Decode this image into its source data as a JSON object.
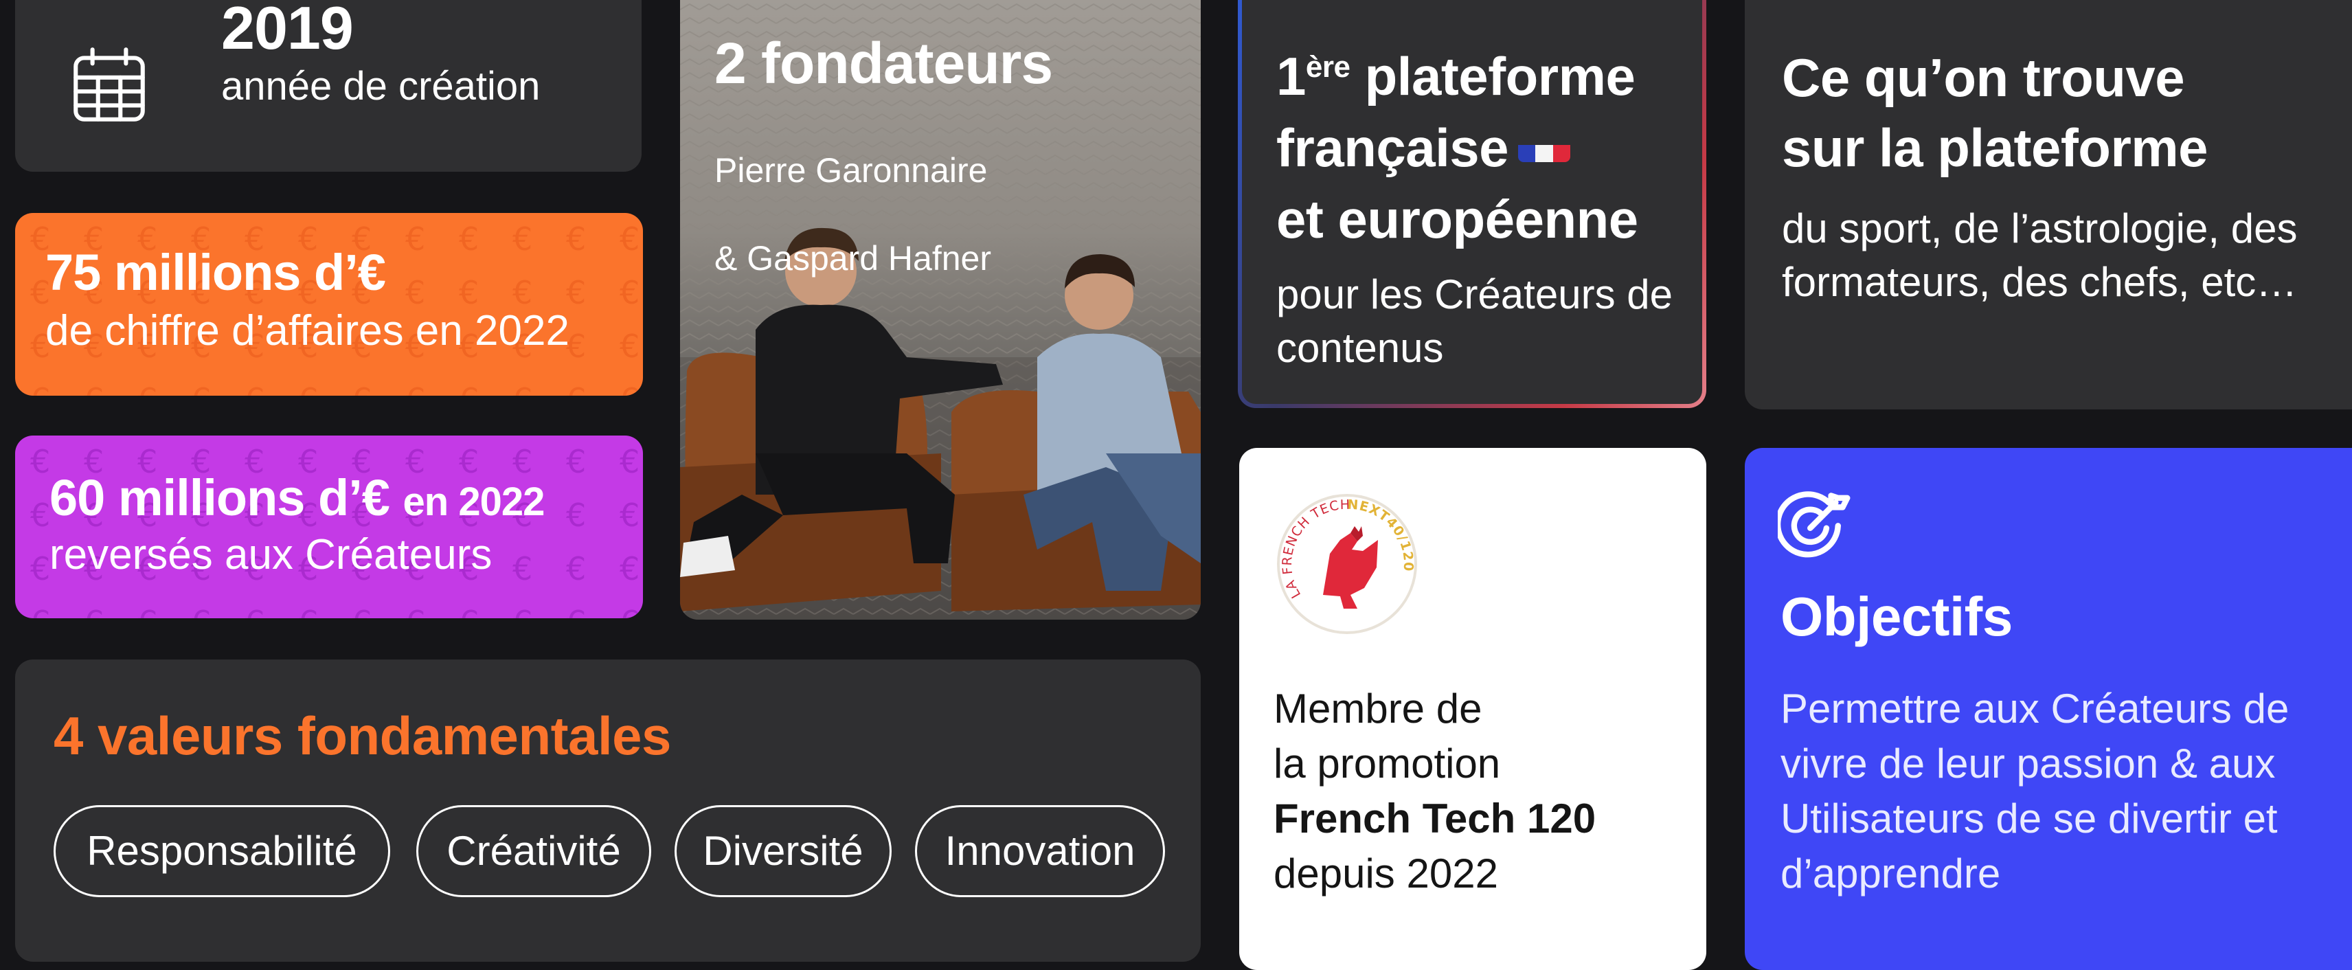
{
  "year_card": {
    "value": "2019",
    "label": "année de création",
    "icon": "calendar-icon"
  },
  "revenue_card": {
    "headline": "75 millions d’€",
    "label": "de chiffre d’affaires en 2022",
    "color": "#fb742c"
  },
  "payout_card": {
    "headline": "60 millions d’€",
    "headline_suffix": "en 2022",
    "label": "reversés aux Créateurs",
    "color": "#c43ae6"
  },
  "founders_card": {
    "title": "2 fondateurs",
    "names": [
      "Pierre Garonnaire",
      "& Gaspard Hafner"
    ]
  },
  "platform_card": {
    "rank": "1",
    "rank_suffix": "ère",
    "line1": "plateforme",
    "line2": "française",
    "line3": "et européenne",
    "flag_icon": "french-flag-icon",
    "subtitle": "pour les Créateurs de contenus"
  },
  "content_card": {
    "title_line1": "Ce qu’on trouve",
    "title_line2": "sur la plateforme",
    "body": "du sport, de l’astrologie, des formateurs, des chefs, etc…"
  },
  "values_card": {
    "title": "4 valeurs fondamentales",
    "values": [
      "Responsabilité",
      "Créativité",
      "Diversité",
      "Innovation"
    ]
  },
  "frenchtech_card": {
    "logo_icon": "french-tech-rooster-logo",
    "logo_text": "LA FRENCH TECH",
    "logo_badge": "NEXT40/120",
    "lines": [
      "Membre de",
      "la promotion"
    ],
    "strong": "French Tech 120",
    "since": "depuis 2022"
  },
  "objectives_card": {
    "icon": "target-arrow-icon",
    "title": "Objectifs",
    "body": "Permettre aux Créateurs de vivre de leur passion & aux Utilisateurs de se divertir et d’apprendre",
    "color": "#3f47f6"
  }
}
